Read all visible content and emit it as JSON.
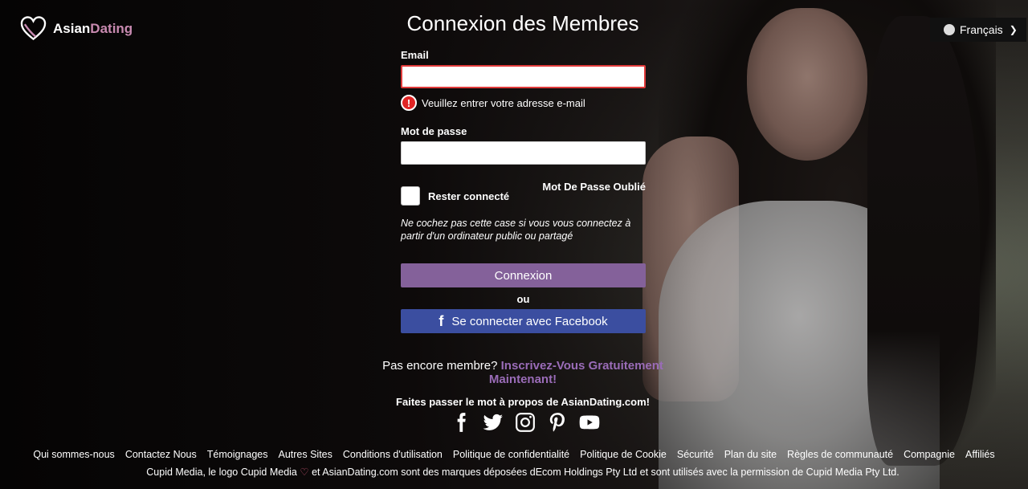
{
  "brand": {
    "name_part1": "Asian",
    "name_part2": "Dating"
  },
  "language": {
    "selected": "Français"
  },
  "login": {
    "title": "Connexion des Membres",
    "email_label": "Email",
    "email_value": "",
    "email_error": "Veuillez entrer votre adresse e-mail",
    "password_label": "Mot de passe",
    "password_value": "",
    "forgot_password": "Mot De Passe Oublié",
    "remember_label": "Rester connecté",
    "remember_note": "Ne cochez pas cette case si vous vous connectez à partir d'un ordinateur public ou partagé",
    "login_button": "Connexion",
    "or_text": "ou",
    "facebook_button": "Se connecter avec Facebook"
  },
  "signup": {
    "prompt": "Pas encore membre?",
    "link": "Inscrivez-Vous Gratuitement Maintenant!"
  },
  "share": {
    "text": "Faites passer le mot à propos de AsianDating.com!",
    "icons": [
      "facebook-icon",
      "twitter-icon",
      "instagram-icon",
      "pinterest-icon",
      "youtube-icon"
    ]
  },
  "footer": {
    "links": [
      "Qui sommes-nous",
      "Contactez Nous",
      "Témoignages",
      "Autres Sites",
      "Conditions d'utilisation",
      "Politique de confidentialité",
      "Politique de Cookie",
      "Sécurité",
      "Plan du site",
      "Règles de communauté",
      "Compagnie",
      "Affiliés"
    ],
    "copyright_part1": "Cupid Media, le logo Cupid Media",
    "copyright_part2": "et AsianDating.com sont des marques déposées dEcom Holdings Pty Ltd et sont utilisés avec la permission de Cupid Media Pty Ltd."
  },
  "colors": {
    "accent": "#84619a",
    "facebook": "#3b4ea0",
    "error": "#e02424",
    "brand_pink": "#c88ab0"
  }
}
